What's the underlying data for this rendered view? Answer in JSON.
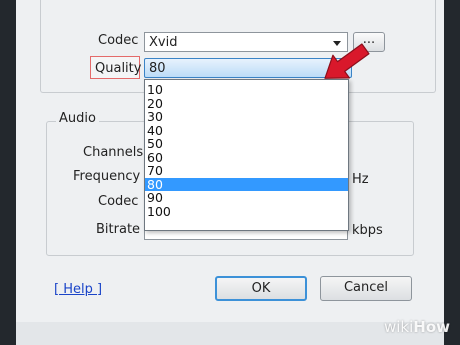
{
  "video": {
    "codec_label": "Codec",
    "codec_value": "Xvid",
    "ellipsis_label": "...",
    "quality_label": "Quality",
    "quality_value": "80"
  },
  "quality_dropdown": {
    "options": [
      "10",
      "20",
      "30",
      "40",
      "50",
      "60",
      "70",
      "80",
      "90",
      "100"
    ],
    "selected": "80"
  },
  "audio": {
    "group_title": "Audio",
    "channels_label": "Channels",
    "frequency_label": "Frequency",
    "frequency_unit": "Hz",
    "codec_label": "Codec",
    "bitrate_label": "Bitrate",
    "bitrate_unit": "kbps"
  },
  "footer": {
    "help_link": "[ Help ]",
    "ok_label": "OK",
    "cancel_label": "Cancel"
  },
  "watermark": {
    "text_wiki": "wiki",
    "text_how": "How"
  },
  "colors": {
    "highlight": "#3399ff",
    "annotation_red": "#d9182b",
    "frame": "#23282d"
  }
}
